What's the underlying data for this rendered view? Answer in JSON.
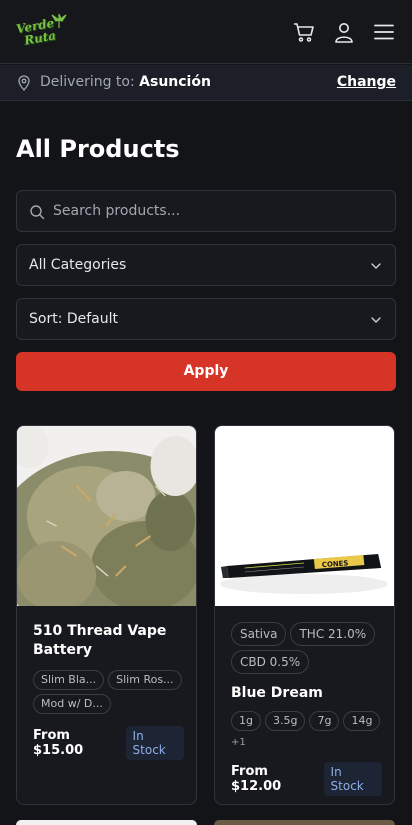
{
  "header": {
    "logo_line1": "Verde",
    "logo_line2": "Ruta",
    "icons": [
      "cart-icon",
      "user-icon",
      "menu-icon"
    ]
  },
  "delivery": {
    "prefix": "Delivering to:",
    "city": "Asunción",
    "change_label": "Change"
  },
  "page": {
    "title": "All Products"
  },
  "filters": {
    "search_placeholder": "Search products...",
    "category_value": "All Categories",
    "sort_value": "Sort: Default",
    "apply_label": "Apply"
  },
  "products": [
    {
      "name": "510 Thread Vape Battery",
      "chips": [
        "Slim Bla...",
        "Slim Ros...",
        "Mod w/ D..."
      ],
      "price": "From $15.00",
      "stock": "In Stock"
    },
    {
      "name": "Blue Dream",
      "tags": [
        "Sativa",
        "THC 21.0%",
        "CBD 0.5%"
      ],
      "sizes": [
        "1g",
        "3.5g",
        "7g",
        "14g"
      ],
      "more": "+1",
      "price": "From $12.00",
      "stock": "In Stock"
    }
  ],
  "colors": {
    "accent": "#d63426",
    "background": "#121418",
    "stock_text": "#8eaee8"
  }
}
